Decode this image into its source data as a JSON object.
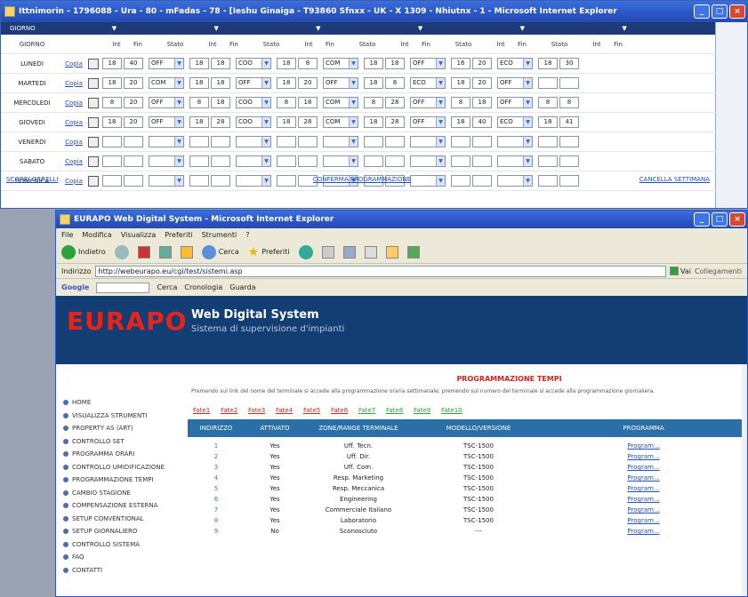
{
  "win1": {
    "title": "Ittnimorin - 1796088 - Ura - 80 - mFadas - 78 - [Ieshu Ginaiga - T93860 Sfnxx - UK - X 1309 - Nhiutnx - 1 - Microsoft Internet Explorer",
    "section_labels": [
      "GIORNO",
      "",
      "",
      "",
      "",
      "",
      "",
      "",
      ""
    ],
    "headers": [
      "GIORNO",
      "",
      "",
      "Int",
      "Fin",
      "Stato",
      "Int",
      "Fin",
      "Stato",
      "Int",
      "Fin",
      "Stato",
      "Int",
      "Fin",
      "Stato",
      "Int",
      "Fin",
      "Stato",
      "Int",
      "Fin"
    ],
    "rows": [
      {
        "day": "LUNEDI",
        "link": "Copia",
        "values": [
          "18",
          "40",
          "OFF",
          "18",
          "18",
          "COO",
          "18",
          "8",
          "COM",
          "18",
          "18",
          "OFF",
          "16",
          "20",
          "ECO",
          "18",
          "30"
        ]
      },
      {
        "day": "MARTEDI",
        "link": "Copia",
        "values": [
          "18",
          "20",
          "COM",
          "18",
          "18",
          "OFF",
          "18",
          "20",
          "OFF",
          "18",
          "8",
          "ECO",
          "18",
          "20",
          "OFF",
          "",
          ""
        ]
      },
      {
        "day": "MERCOLEDI",
        "link": "Copia",
        "values": [
          "8",
          "20",
          "OFF",
          "8",
          "18",
          "COO",
          "8",
          "18",
          "COM",
          "8",
          "28",
          "OFF",
          "8",
          "18",
          "OFF",
          "8",
          "8"
        ]
      },
      {
        "day": "GIOVEDI",
        "link": "Copia",
        "values": [
          "18",
          "20",
          "OFF",
          "18",
          "28",
          "COO",
          "18",
          "28",
          "COM",
          "18",
          "28",
          "OFF",
          "18",
          "40",
          "ECO",
          "18",
          "41"
        ]
      },
      {
        "day": "VENERDI",
        "link": "Copia",
        "values": [
          "",
          "",
          "",
          "",
          "",
          "",
          "",
          "",
          "",
          "",
          "",
          "",
          "",
          "",
          "",
          "",
          ""
        ]
      },
      {
        "day": "SABATO",
        "link": "Copia",
        "values": [
          "",
          "",
          "",
          "",
          "",
          "",
          "",
          "",
          "",
          "",
          "",
          "",
          "",
          "",
          "",
          "",
          ""
        ]
      },
      {
        "day": "DOMENICA",
        "link": "Copia",
        "values": [
          "",
          "",
          "",
          "",
          "",
          "",
          "",
          "",
          "",
          "",
          "",
          "",
          "",
          "",
          "",
          "",
          ""
        ]
      }
    ],
    "footer_left": "SCORRI ORRELLI",
    "footer_center": "CONFERMA PROGRAMMAZIONE",
    "footer_right": "CANCELLA SETTIMANA"
  },
  "win2": {
    "title": "EURAPO Web Digital System - Microsoft Internet Explorer",
    "menu": [
      "File",
      "Modifica",
      "Visualizza",
      "Preferiti",
      "Strumenti",
      "?"
    ],
    "back_label": "Indietro",
    "search_label": "Cerca",
    "favorites_label": "Preferiti",
    "address_label": "Indirizzo",
    "address_value": "http://webeurapo.eu/cgi/test/sistemi.asp",
    "go_label": "Vai",
    "links_label": "Collegamenti",
    "google_label": "Google",
    "google_items": [
      "Cerca",
      "Cronologia",
      "Guarda"
    ],
    "logo": "EURAPO",
    "brand_title": "Web Digital System",
    "brand_subtitle": "Sistema di supervisione d'impianti",
    "nav": [
      "HOME",
      "VISUALIZZA STRUMENTI",
      "PROPERTY AS (ART)",
      "CONTROLLO SET",
      "PROGRAMMA ORARI",
      "CONTROLLO UMIDIFICAZIONE",
      "PROGRAMMAZIONE TEMPI",
      "CAMBIO STAGIONE",
      "COMPENSAZIONE ESTERNA",
      "SETUP CONVENTIONAL",
      "SETUP GIORNALIERO",
      "CONTROLLO SISTEMA",
      "FAQ",
      "CONTATTI"
    ],
    "content_title": "PROGRAMMAZIONE TEMPI",
    "content_desc": "Premendo sul link del nome del terminale si accede alla programmazione oraria settimanale; premendo sul numero del terminale si accede alla programmazione giornaliera.",
    "rooms": [
      "Fate1",
      "Fate2",
      "Fate3",
      "Fate4",
      "Fate5",
      "Fate6",
      "Fate7",
      "Fate8",
      "Fate9",
      "Fate10"
    ],
    "table_headers": [
      "INDIRIZZO",
      "ATTIVATO",
      "ZONE/RANGE TERMINALE",
      "MODELLO/VERSIONE",
      "PROGRAMMA"
    ],
    "table_rows": [
      {
        "id": "1",
        "active": "Yes",
        "name": "Uff. Tecn.",
        "model": "TSC-1500",
        "link": "Program..."
      },
      {
        "id": "2",
        "active": "Yes",
        "name": "Uff. Dir.",
        "model": "TSC-1500",
        "link": "Program..."
      },
      {
        "id": "3",
        "active": "Yes",
        "name": "Uff. Com.",
        "model": "TSC-1500",
        "link": "Program..."
      },
      {
        "id": "4",
        "active": "Yes",
        "name": "Resp. Marketing",
        "model": "TSC-1500",
        "link": "Program..."
      },
      {
        "id": "5",
        "active": "Yes",
        "name": "Resp. Meccanica",
        "model": "TSC-1500",
        "link": "Program..."
      },
      {
        "id": "6",
        "active": "Yes",
        "name": "Engineering",
        "model": "TSC-1500",
        "link": "Program..."
      },
      {
        "id": "7",
        "active": "Yes",
        "name": "Commerciale Italiano",
        "model": "TSC-1500",
        "link": "Program..."
      },
      {
        "id": "8",
        "active": "Yes",
        "name": "Laboratorio",
        "model": "TSC-1500",
        "link": "Program..."
      },
      {
        "id": "9",
        "active": "No",
        "name": "Sconosciuto",
        "model": "---",
        "link": "Program..."
      }
    ]
  }
}
